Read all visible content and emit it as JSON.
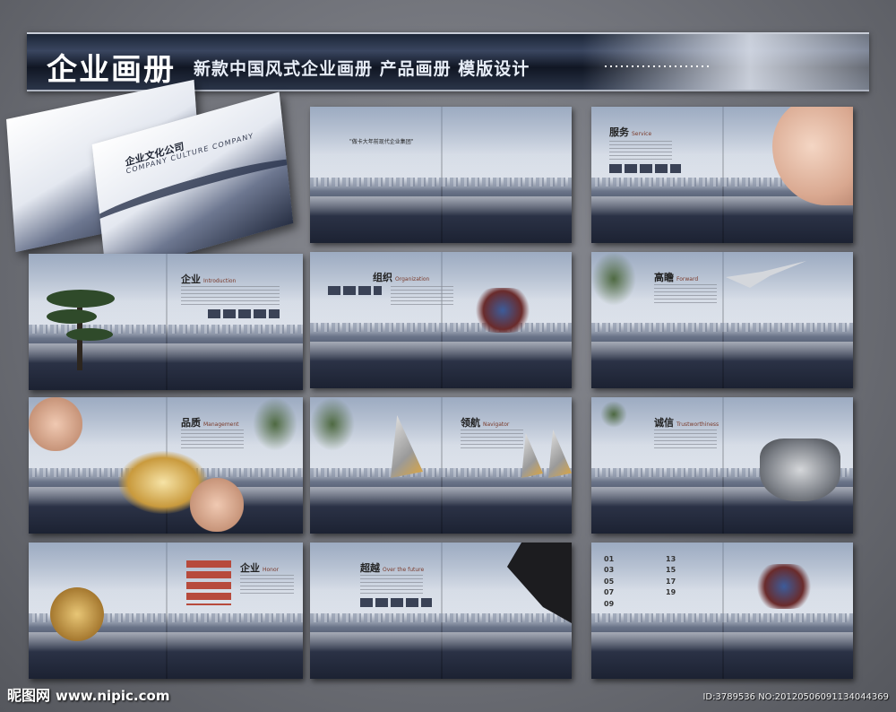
{
  "banner": {
    "title": "企业画册",
    "subtitle": "新款中国风式企业画册 产品画册 模版设计"
  },
  "cover": {
    "title": "企业文化公司",
    "subtitle": "COMPANY CULTURE COMPANY"
  },
  "spreads": {
    "s1": {
      "quote": "\"做卡大年前现代企业集团\""
    },
    "s2": {
      "heading": "服务",
      "heading_en": "Service"
    },
    "s3": {
      "heading": "企业",
      "heading_en": "Introduction"
    },
    "s4": {
      "heading": "组织",
      "heading_en": "Organization"
    },
    "s5": {
      "heading": "高瞻",
      "heading_en": "Forward"
    },
    "s6": {
      "heading": "品质",
      "heading_en": "Management"
    },
    "s7": {
      "heading": "领航",
      "heading_en": "Navigator"
    },
    "s8": {
      "heading": "诚信",
      "heading_en": "Trustworthiness"
    },
    "s9": {
      "heading": "企业",
      "heading_en": "Honor"
    },
    "s10": {
      "heading": "超越",
      "heading_en": "Over the future"
    },
    "s11": {
      "times": [
        "01",
        "13",
        "03",
        "15",
        "05",
        "17",
        "07",
        "19",
        "09",
        ""
      ]
    }
  },
  "footer": {
    "brand": "昵图网",
    "url": "www.nipic.com",
    "id_text": "ID:3789536 NO:20120506091134044369"
  }
}
